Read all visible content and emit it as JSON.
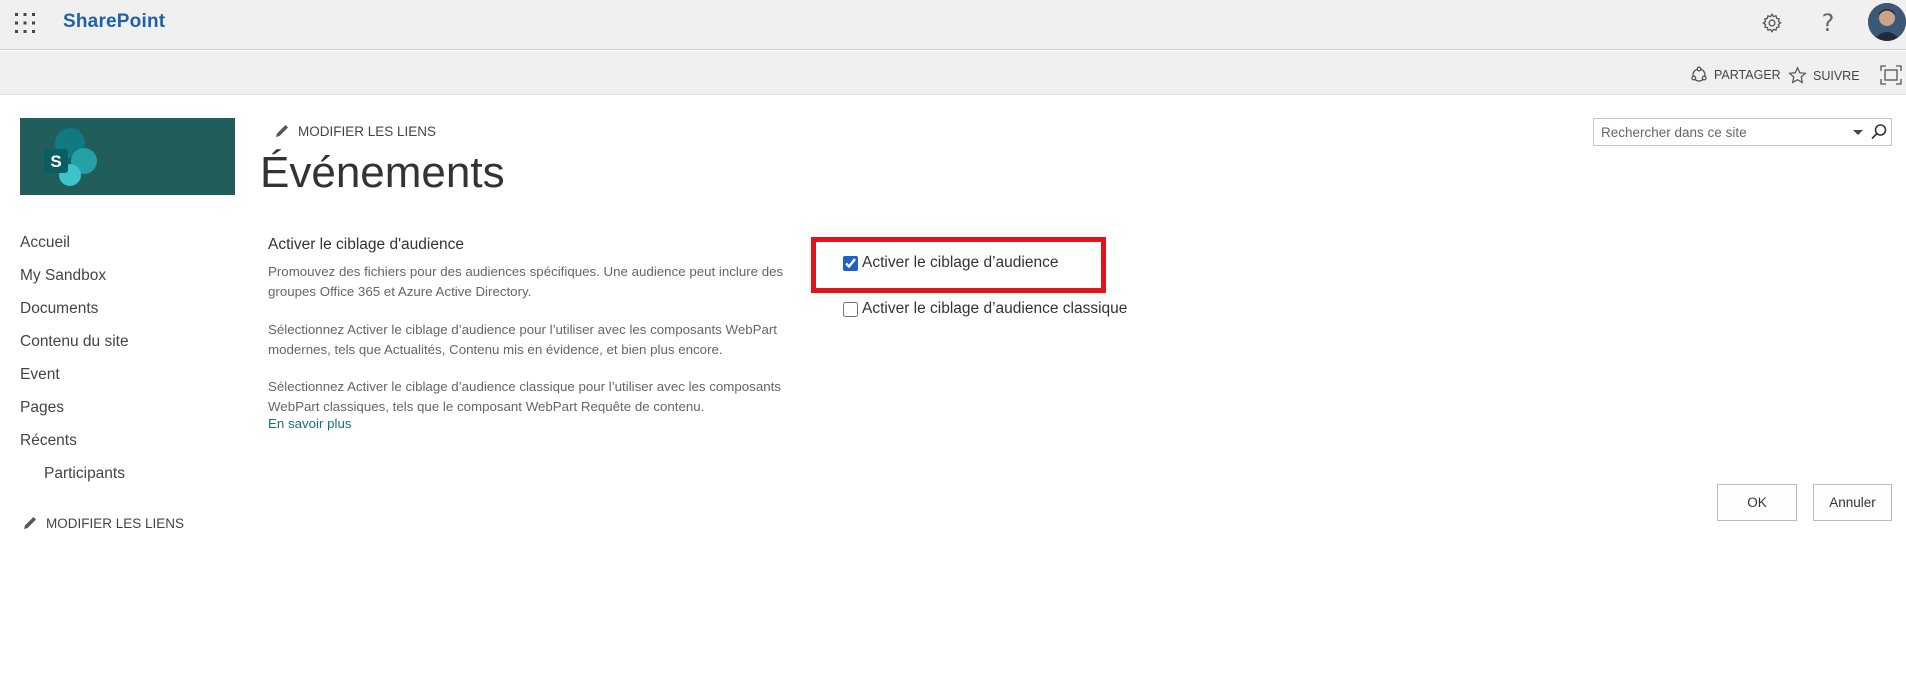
{
  "suite_bar": {
    "brand": "SharePoint",
    "icons": [
      "app-launcher-icon",
      "gear-icon",
      "help-icon",
      "avatar"
    ],
    "help_glyph": "?"
  },
  "action_bar": {
    "share_label": "PARTAGER",
    "follow_label": "SUIVRE"
  },
  "header": {
    "edit_links_label": "MODIFIER LES LIENS",
    "page_title": "Événements",
    "logo_letter": "S"
  },
  "search": {
    "placeholder": "Rechercher dans ce site"
  },
  "left_nav": {
    "items": [
      {
        "label": "Accueil"
      },
      {
        "label": "My Sandbox"
      },
      {
        "label": "Documents"
      },
      {
        "label": "Contenu du site"
      },
      {
        "label": "Event"
      },
      {
        "label": "Pages"
      },
      {
        "label": "Récents"
      },
      {
        "label": "Participants"
      }
    ],
    "edit_links_label": "MODIFIER LES LIENS"
  },
  "section": {
    "title": "Activer le ciblage d'audience",
    "paragraphs": [
      "Promouvez des fichiers pour des audiences spécifiques. Une audience peut inclure des groupes Office 365 et Azure Active Directory.",
      "Sélectionnez Activer le ciblage d’audience pour l’utiliser avec les composants WebPart modernes, tels que Actualités, Contenu mis en évidence, et bien plus encore.",
      "Sélectionnez Activer le ciblage d’audience classique pour l’utiliser avec les composants WebPart classiques, tels que le composant WebPart Requête de contenu."
    ],
    "learn_more": "En savoir plus"
  },
  "options": {
    "enable_targeting": {
      "label": "Activer le ciblage d’audience",
      "checked": true
    },
    "enable_classic_targeting": {
      "label": "Activer le ciblage d’audience classique",
      "checked": false
    },
    "highlight_color": "#e1141a"
  },
  "buttons": {
    "ok": "OK",
    "cancel": "Annuler"
  },
  "colors": {
    "brand": "#1e62a8",
    "logo_bg": "#215e5b",
    "link": "#1a6f7e"
  }
}
